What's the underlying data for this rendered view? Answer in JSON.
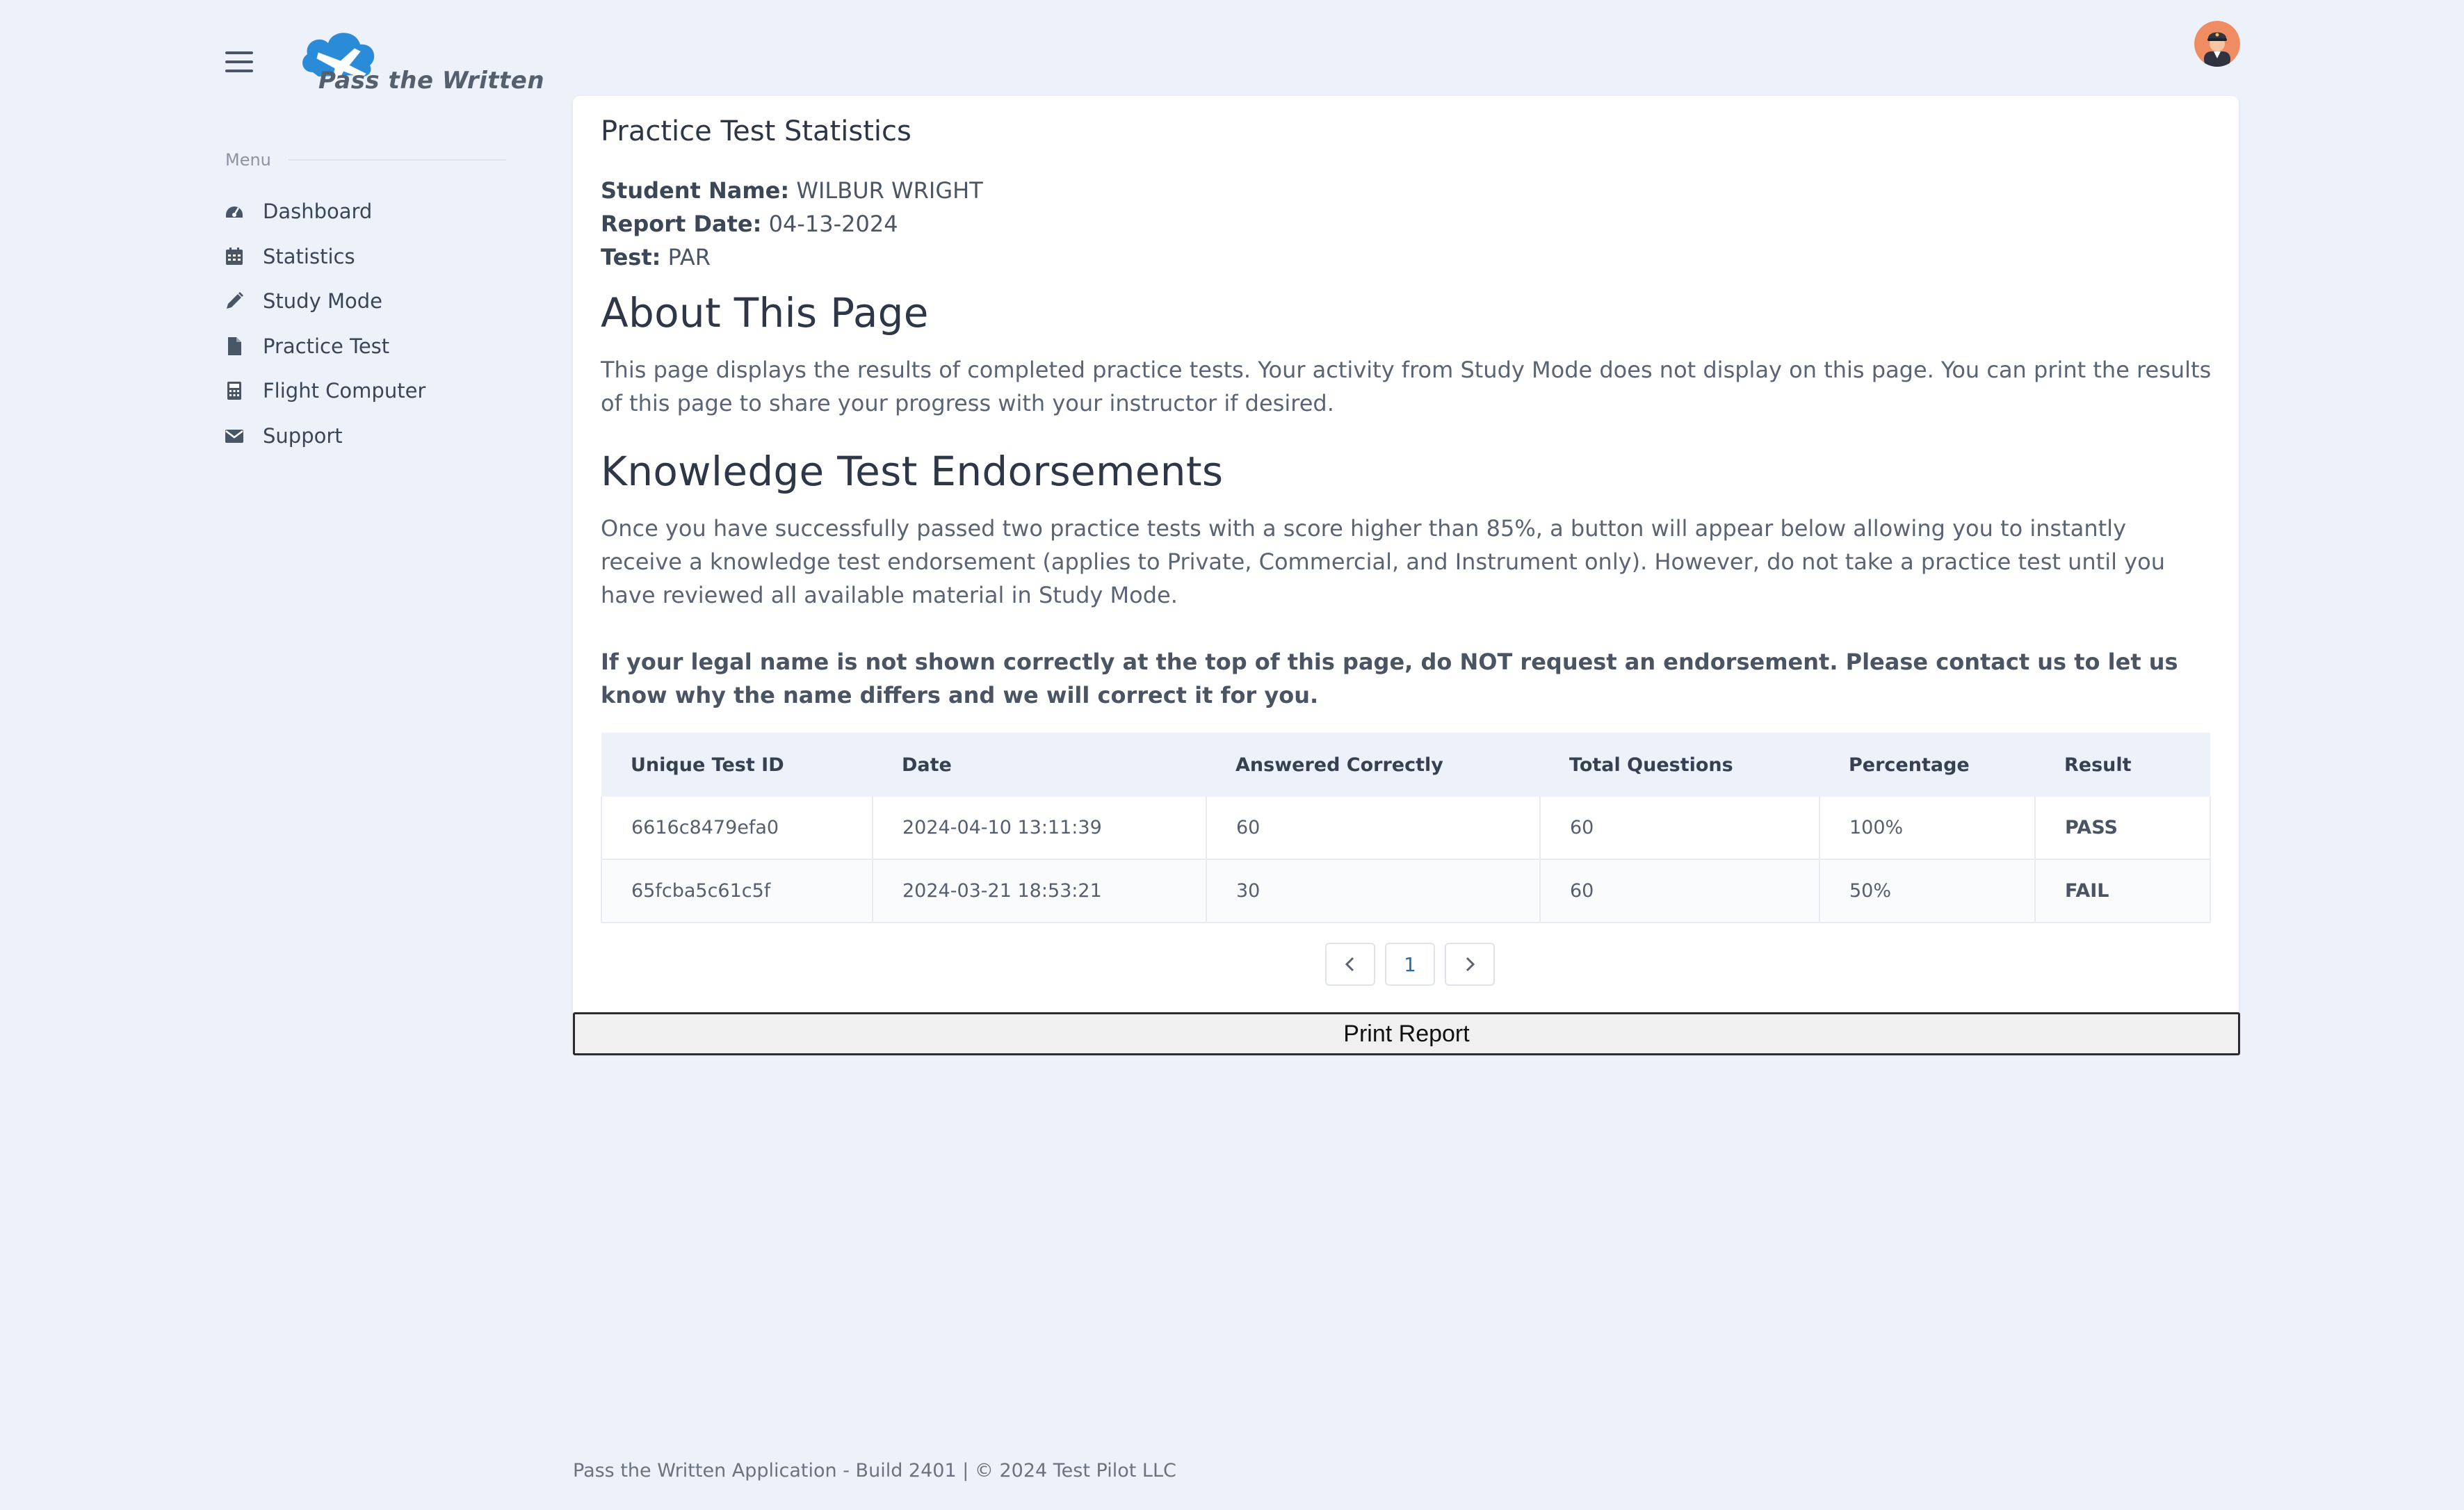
{
  "header": {
    "logo_text": "Pass the Written"
  },
  "sidebar": {
    "menu_heading": "Menu",
    "items": [
      {
        "label": "Dashboard",
        "icon": "dashboard-icon"
      },
      {
        "label": "Statistics",
        "icon": "calendar-icon"
      },
      {
        "label": "Study Mode",
        "icon": "pencil-icon"
      },
      {
        "label": "Practice Test",
        "icon": "file-icon"
      },
      {
        "label": "Flight Computer",
        "icon": "calculator-icon"
      },
      {
        "label": "Support",
        "icon": "envelope-icon"
      }
    ]
  },
  "card": {
    "title": "Practice Test Statistics",
    "student_label": "Student Name:",
    "student_value": "WILBUR WRIGHT",
    "report_label": "Report Date:",
    "report_value": "04-13-2024",
    "test_label": "Test:",
    "test_value": "PAR",
    "about_heading": "About This Page",
    "about_text": "This page displays the results of completed practice tests. Your activity from Study Mode does not display on this page. You can print the results of this page to share your progress with your instructor if desired.",
    "endorse_heading": "Knowledge Test Endorsements",
    "endorse_text": "Once you have successfully passed two practice tests with a score higher than 85%, a button will appear below allowing you to instantly receive a knowledge test endorsement (applies to Private, Commercial, and Instrument only). However, do not take a practice test until you have reviewed all available material in Study Mode.",
    "warning_text": "If your legal name is not shown correctly at the top of this page, do NOT request an endorsement. Please contact us to let us know why the name differs and we will correct it for you."
  },
  "table": {
    "headers": [
      "Unique Test ID",
      "Date",
      "Answered Correctly",
      "Total Questions",
      "Percentage",
      "Result"
    ],
    "rows": [
      [
        "6616c8479efa0",
        "2024-04-10 13:11:39",
        "60",
        "60",
        "100%",
        "PASS"
      ],
      [
        "65fcba5c61c5f",
        "2024-03-21 18:53:21",
        "30",
        "60",
        "50%",
        "FAIL"
      ]
    ]
  },
  "pagination": {
    "prev": "‹",
    "current": "1",
    "next": "›"
  },
  "print_button": "Print Report",
  "footer": "Pass the Written Application - Build 2401 | © 2024 Test Pilot LLC",
  "colors": {
    "background": "#edf1fa",
    "card": "#ffffff",
    "accent": "#1f6fb5",
    "logo_cloud": "#2a8bd8"
  }
}
